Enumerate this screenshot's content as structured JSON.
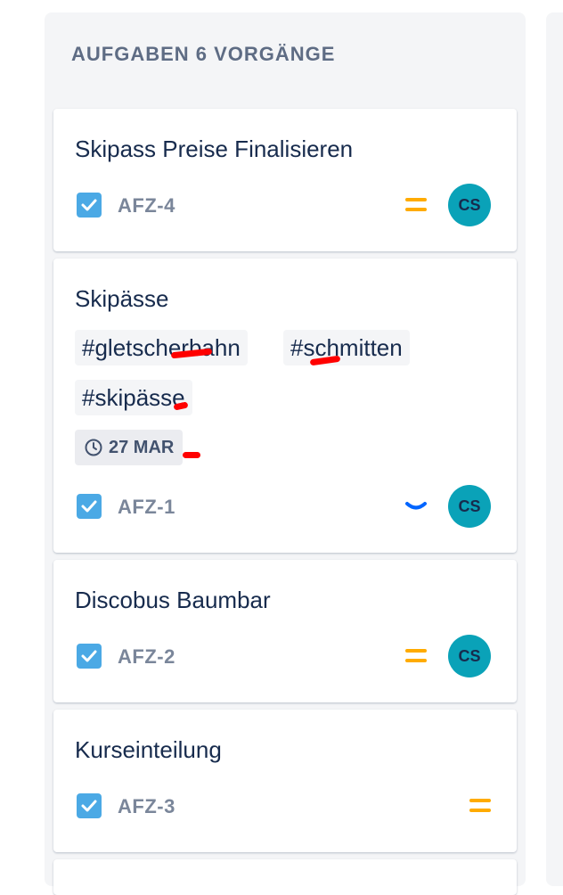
{
  "column": {
    "header": "AUFGABEN 6 VORGÄNGE"
  },
  "cards": [
    {
      "title": "Skipass Preise Finalisieren",
      "key": "AFZ-4",
      "priority": "medium",
      "assignee_initials": "CS"
    },
    {
      "title": "Skipässe",
      "labels": [
        "#gletscherbahn",
        "#schmitten",
        "#skipässe"
      ],
      "due_date": "27 MAR",
      "key": "AFZ-1",
      "priority": "low",
      "assignee_initials": "CS"
    },
    {
      "title": "Discobus Baumbar",
      "key": "AFZ-2",
      "priority": "medium",
      "assignee_initials": "CS"
    },
    {
      "title": "Kurseinteilung",
      "key": "AFZ-3",
      "priority": "medium"
    }
  ],
  "colors": {
    "priority_medium": "#ffab00",
    "priority_low": "#0065ff",
    "checkbox": "#4ba9e5",
    "avatar": "#0aa2b8",
    "annotation_marks": "#ff0000"
  }
}
